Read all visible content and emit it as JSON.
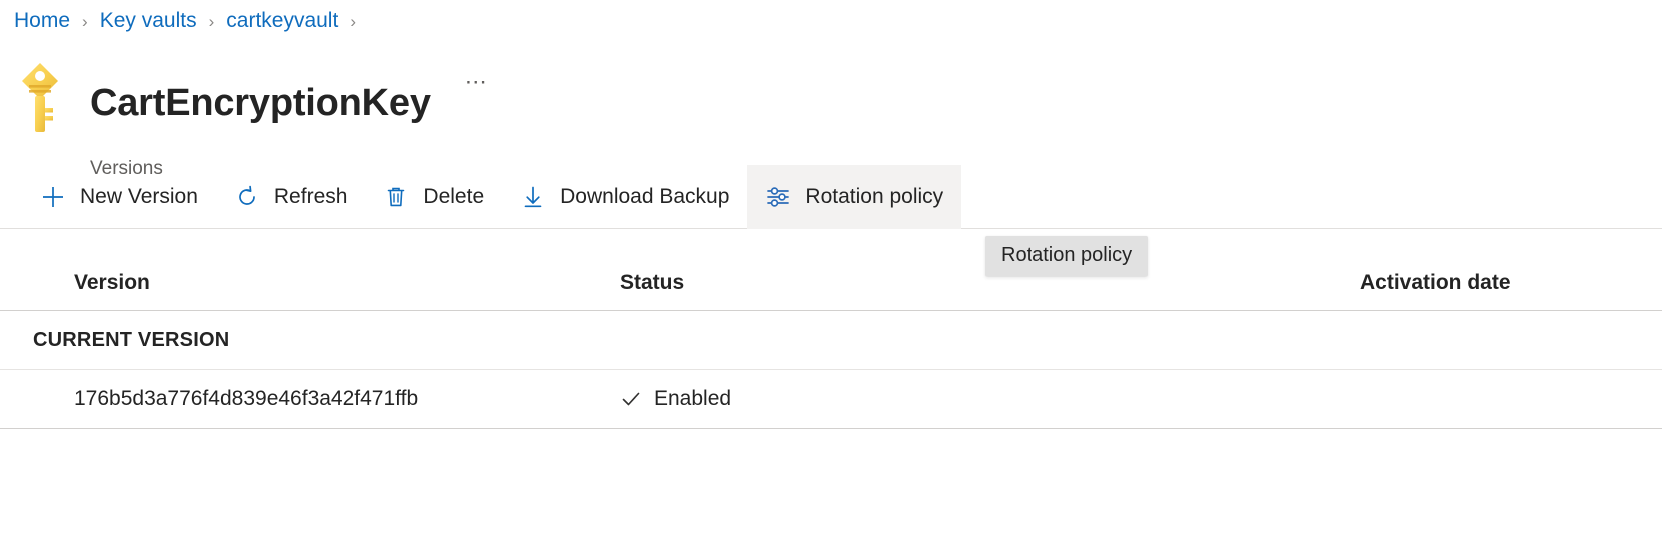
{
  "breadcrumb": {
    "items": [
      {
        "label": "Home"
      },
      {
        "label": "Key vaults"
      },
      {
        "label": "cartkeyvault"
      }
    ],
    "separator": "›"
  },
  "header": {
    "icon": "key-icon",
    "title": "CartEncryptionKey",
    "subtitle": "Versions",
    "more_label": "⋯"
  },
  "command_bar": {
    "buttons": [
      {
        "label": "New Version",
        "icon": "plus-icon",
        "hovered": false
      },
      {
        "label": "Refresh",
        "icon": "refresh-icon",
        "hovered": false
      },
      {
        "label": "Delete",
        "icon": "trash-icon",
        "hovered": false
      },
      {
        "label": "Download Backup",
        "icon": "download-icon",
        "hovered": false
      },
      {
        "label": "Rotation policy",
        "icon": "sliders-icon",
        "hovered": true
      }
    ]
  },
  "tooltip": {
    "text": "Rotation policy"
  },
  "table": {
    "columns": [
      {
        "label": "Version"
      },
      {
        "label": "Status"
      },
      {
        "label": "Activation date"
      }
    ],
    "groups": [
      {
        "label": "CURRENT VERSION",
        "rows": [
          {
            "version": "176b5d3a776f4d839e46f3a42f471ffb",
            "status": "Enabled",
            "status_icon": "checkmark-icon",
            "activation_date": ""
          }
        ]
      }
    ]
  },
  "colors": {
    "link": "#0f6cbd",
    "accent": "#0f6cbd",
    "text": "#242424",
    "subtle_text": "#605e5c",
    "divider": "#d2d0ce",
    "hover_bg": "#f3f2f1",
    "tooltip_bg": "#e1e1e1",
    "key_gold": "#f5c544"
  }
}
